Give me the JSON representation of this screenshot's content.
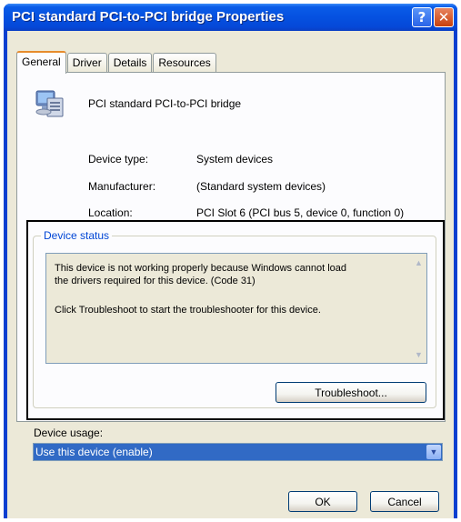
{
  "window": {
    "title": "PCI standard PCI-to-PCI bridge Properties",
    "help_glyph": "?",
    "close_glyph": "✕"
  },
  "tabs": [
    {
      "label": "General",
      "active": true
    },
    {
      "label": "Driver",
      "active": false
    },
    {
      "label": "Details",
      "active": false
    },
    {
      "label": "Resources",
      "active": false
    }
  ],
  "device": {
    "name": "PCI standard PCI-to-PCI bridge",
    "icon": "computer-device-icon",
    "properties": [
      {
        "label": "Device type:",
        "value": "System devices"
      },
      {
        "label": "Manufacturer:",
        "value": "(Standard system devices)"
      },
      {
        "label": "Location:",
        "value": "PCI Slot 6 (PCI bus 5, device 0, function 0)"
      }
    ]
  },
  "status": {
    "legend": "Device status",
    "lines": [
      "This device is not working properly because Windows cannot load",
      "the drivers required for this device. (Code 31)",
      "Click Troubleshoot to start the troubleshooter for this device."
    ],
    "troubleshoot_label": "Troubleshoot..."
  },
  "usage": {
    "label": "Device usage:",
    "selected": "Use this device (enable)"
  },
  "footer": {
    "ok_label": "OK",
    "cancel_label": "Cancel"
  },
  "colors": {
    "titlebar": "#0551e0",
    "dialog_bg": "#ece9d8",
    "legend_text": "#0046d5",
    "select_highlight": "#316ac5",
    "annotation_frame": "#000000"
  }
}
